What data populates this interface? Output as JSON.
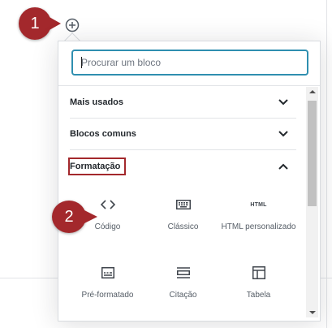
{
  "markers": {
    "step1": "1",
    "step2": "2"
  },
  "search": {
    "placeholder": "Procurar um bloco",
    "value": ""
  },
  "panels": [
    {
      "label": "Mais usados",
      "state": "collapsed"
    },
    {
      "label": "Blocos comuns",
      "state": "collapsed"
    },
    {
      "label": "Formatação",
      "state": "expanded"
    }
  ],
  "blocks": [
    {
      "label": "Código",
      "icon": "code-icon"
    },
    {
      "label": "Clássico",
      "icon": "keyboard-icon"
    },
    {
      "label": "HTML personalizado",
      "icon": "html-icon",
      "icon_text": "HTML"
    },
    {
      "label": "Pré-formatado",
      "icon": "preformatted-icon"
    },
    {
      "label": "Citação",
      "icon": "pullquote-icon"
    },
    {
      "label": "Tabela",
      "icon": "table-icon"
    }
  ],
  "colors": {
    "marker": "#a3282c",
    "search_border": "#2f8fb0"
  }
}
